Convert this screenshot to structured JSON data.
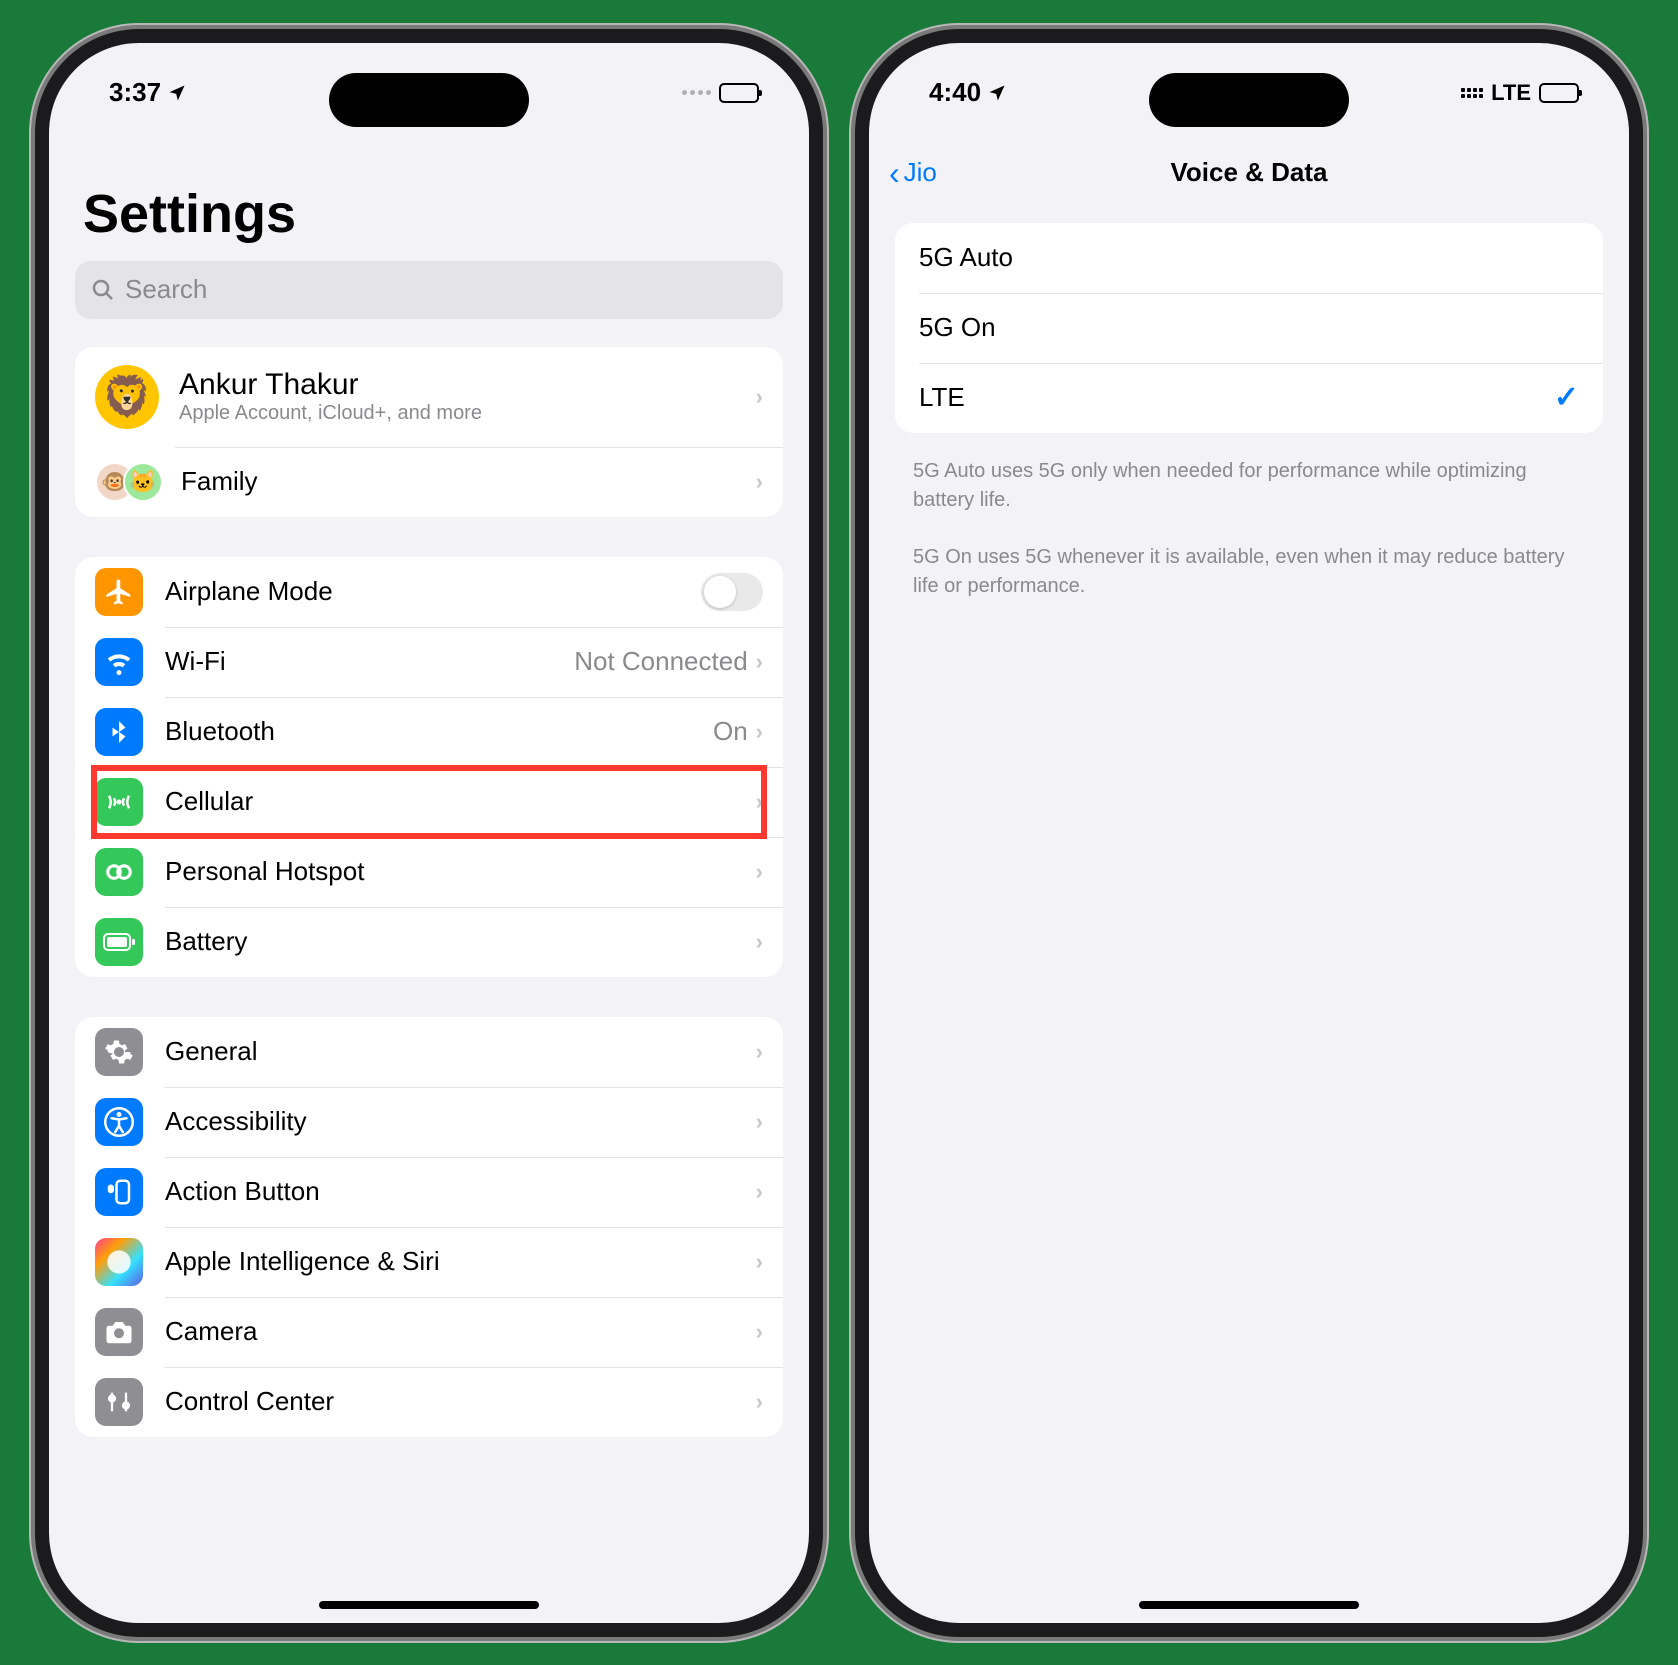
{
  "phone1": {
    "status": {
      "time": "3:37"
    },
    "title": "Settings",
    "search_placeholder": "Search",
    "profile": {
      "name": "Ankur Thakur",
      "subtitle": "Apple Account, iCloud+, and more"
    },
    "family_label": "Family",
    "rows": {
      "airplane": "Airplane Mode",
      "wifi": "Wi-Fi",
      "wifi_detail": "Not Connected",
      "bluetooth": "Bluetooth",
      "bluetooth_detail": "On",
      "cellular": "Cellular",
      "hotspot": "Personal Hotspot",
      "battery": "Battery",
      "general": "General",
      "accessibility": "Accessibility",
      "action_button": "Action Button",
      "siri": "Apple Intelligence & Siri",
      "camera": "Camera",
      "control_center": "Control Center"
    }
  },
  "phone2": {
    "status": {
      "time": "4:40",
      "net": "LTE"
    },
    "back_label": "Jio",
    "title": "Voice & Data",
    "options": {
      "auto5g": "5G Auto",
      "on5g": "5G On",
      "lte": "LTE"
    },
    "footer1": "5G Auto uses 5G only when needed for performance while optimizing battery life.",
    "footer2": "5G On uses 5G whenever it is available, even when it may reduce battery life or performance."
  }
}
